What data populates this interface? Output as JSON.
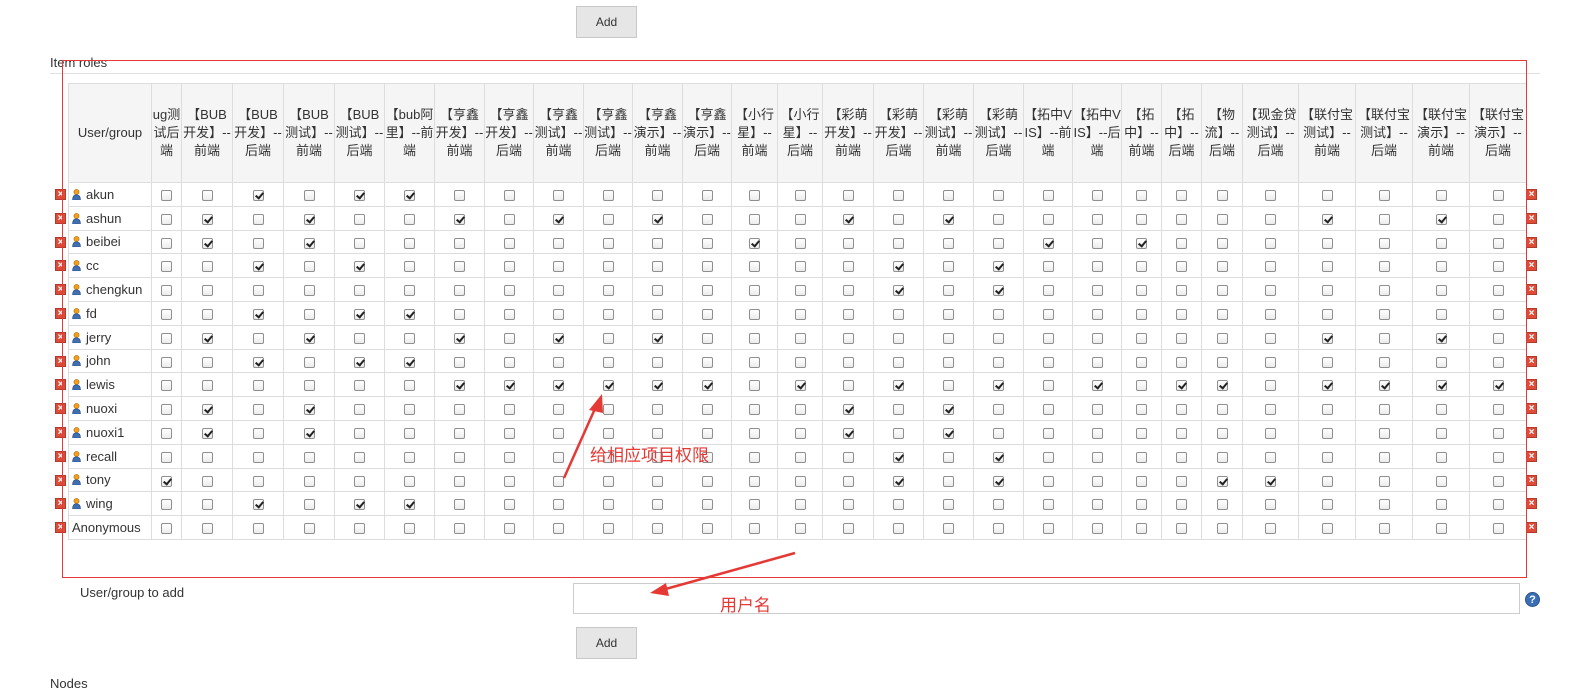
{
  "top_add_button": "Add",
  "section_title": "Item roles",
  "header_user_group": "User/group",
  "columns": [
    "ug测试后端",
    "【BUB开发】--前端",
    "【BUB开发】--后端",
    "【BUB测试】--前端",
    "【BUB测试】--后端",
    "【bub阿里】--前端",
    "【亨鑫开发】--前端",
    "【亨鑫开发】--后端",
    "【亨鑫测试】--前端",
    "【亨鑫测试】--后端",
    "【亨鑫演示】--前端",
    "【亨鑫演示】--后端",
    "【小行星】--前端",
    "【小行星】--后端",
    "【彩萌开发】--前端",
    "【彩萌开发】--后端",
    "【彩萌测试】--前端",
    "【彩萌测试】--后端",
    "【拓中VIS】--前端",
    "【拓中VIS】--后端",
    "【拓中】--前端",
    "【拓中】--后端",
    "【物流】--后端",
    "【现金贷测试】--后端",
    "【联付宝测试】--前端",
    "【联付宝测试】--后端",
    "【联付宝演示】--前端",
    "【联付宝演示】--后端"
  ],
  "rows": [
    {
      "name": "akun",
      "checked": [
        2,
        4,
        5
      ]
    },
    {
      "name": "ashun",
      "checked": [
        1,
        3,
        6,
        8,
        10,
        14,
        16,
        24,
        26
      ]
    },
    {
      "name": "beibei",
      "checked": [
        1,
        3,
        12,
        18,
        20
      ]
    },
    {
      "name": "cc",
      "checked": [
        2,
        4,
        15,
        17
      ]
    },
    {
      "name": "chengkun",
      "checked": [
        15,
        17
      ]
    },
    {
      "name": "fd",
      "checked": [
        2,
        4,
        5
      ]
    },
    {
      "name": "jerry",
      "checked": [
        1,
        3,
        6,
        8,
        10,
        24,
        26
      ]
    },
    {
      "name": "john",
      "checked": [
        2,
        4,
        5
      ]
    },
    {
      "name": "lewis",
      "checked": [
        6,
        7,
        8,
        9,
        10,
        11,
        13,
        15,
        17,
        19,
        21,
        22,
        24,
        25,
        26,
        27
      ]
    },
    {
      "name": "nuoxi",
      "checked": [
        1,
        3,
        14,
        16
      ]
    },
    {
      "name": "nuoxi1",
      "checked": [
        1,
        3,
        14,
        16
      ]
    },
    {
      "name": "recall",
      "checked": [
        15,
        17
      ]
    },
    {
      "name": "tony",
      "checked": [
        0,
        15,
        17,
        22,
        23
      ]
    },
    {
      "name": "wing",
      "checked": [
        2,
        4,
        5
      ]
    },
    {
      "name": "Anonymous",
      "checked": [],
      "anonymous": true
    }
  ],
  "user_group_to_add_label": "User/group to add",
  "user_group_input_value": "",
  "bottom_add_button": "Add",
  "help_icon_glyph": "?",
  "annotation_permissions": "给相应项目权限",
  "annotation_username": "用户名",
  "bottom_text": "Nodes",
  "colors": {
    "annotation": "#e53935",
    "delete_icon": "#dd4b39",
    "user_icon": "#f0a020",
    "header_bg": "#f5f5f5"
  }
}
